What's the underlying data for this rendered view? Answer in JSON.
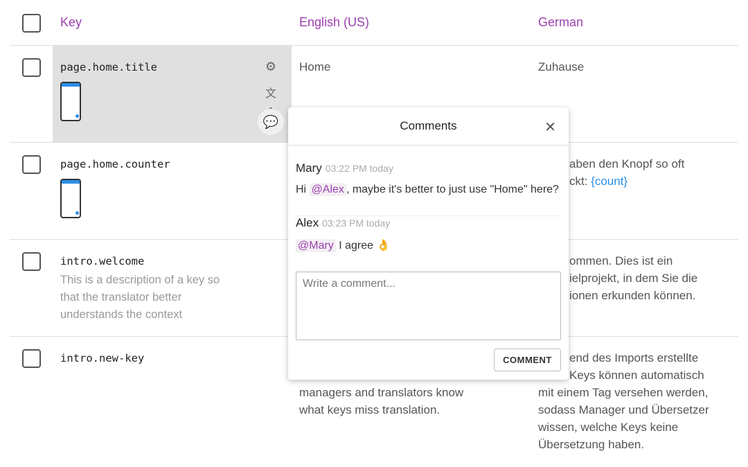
{
  "header": {
    "key": "Key",
    "english": "English (US)",
    "german": "German"
  },
  "rows": [
    {
      "key": "page.home.title",
      "english": "Home",
      "german": "Zuhause"
    },
    {
      "key": "page.home.counter",
      "german_visible": [
        "aben den Knopf so oft",
        "ckt: "
      ],
      "german_placeholder": "{count}"
    },
    {
      "key": "intro.welcome",
      "description": "This is a description of a key so that the translator better understands the context",
      "german_visible": [
        "ommen. Dies ist ein",
        "ielprojekt, in dem Sie die",
        "ionen erkunden können."
      ]
    },
    {
      "key": "intro.new-key",
      "english_visible": [
        "managers and translators know",
        "what keys miss translation."
      ],
      "german_visible": [
        "end des Imports erstellte",
        "Keys können automatisch",
        "mit einem Tag versehen werden,",
        "sodass Manager und Übersetzer",
        "wissen, welche Keys keine",
        "Übersetzung haben."
      ]
    }
  ],
  "comments_popup": {
    "title": "Comments",
    "comments": [
      {
        "author": "Mary",
        "time": "03:22 PM today",
        "pre": "Hi ",
        "mention": "@Alex",
        "post": ", maybe it's better to just use \"Home\" here?"
      },
      {
        "author": "Alex",
        "time": "03:23 PM today",
        "pre": "",
        "mention": "@Mary",
        "post": " I agree 👌"
      }
    ],
    "placeholder": "Write a comment...",
    "submit": "COMMENT"
  },
  "colors": {
    "accent": "#9c3fb0",
    "placeholder": "#2b8fe8",
    "selected_row": "#e0e0e0"
  }
}
